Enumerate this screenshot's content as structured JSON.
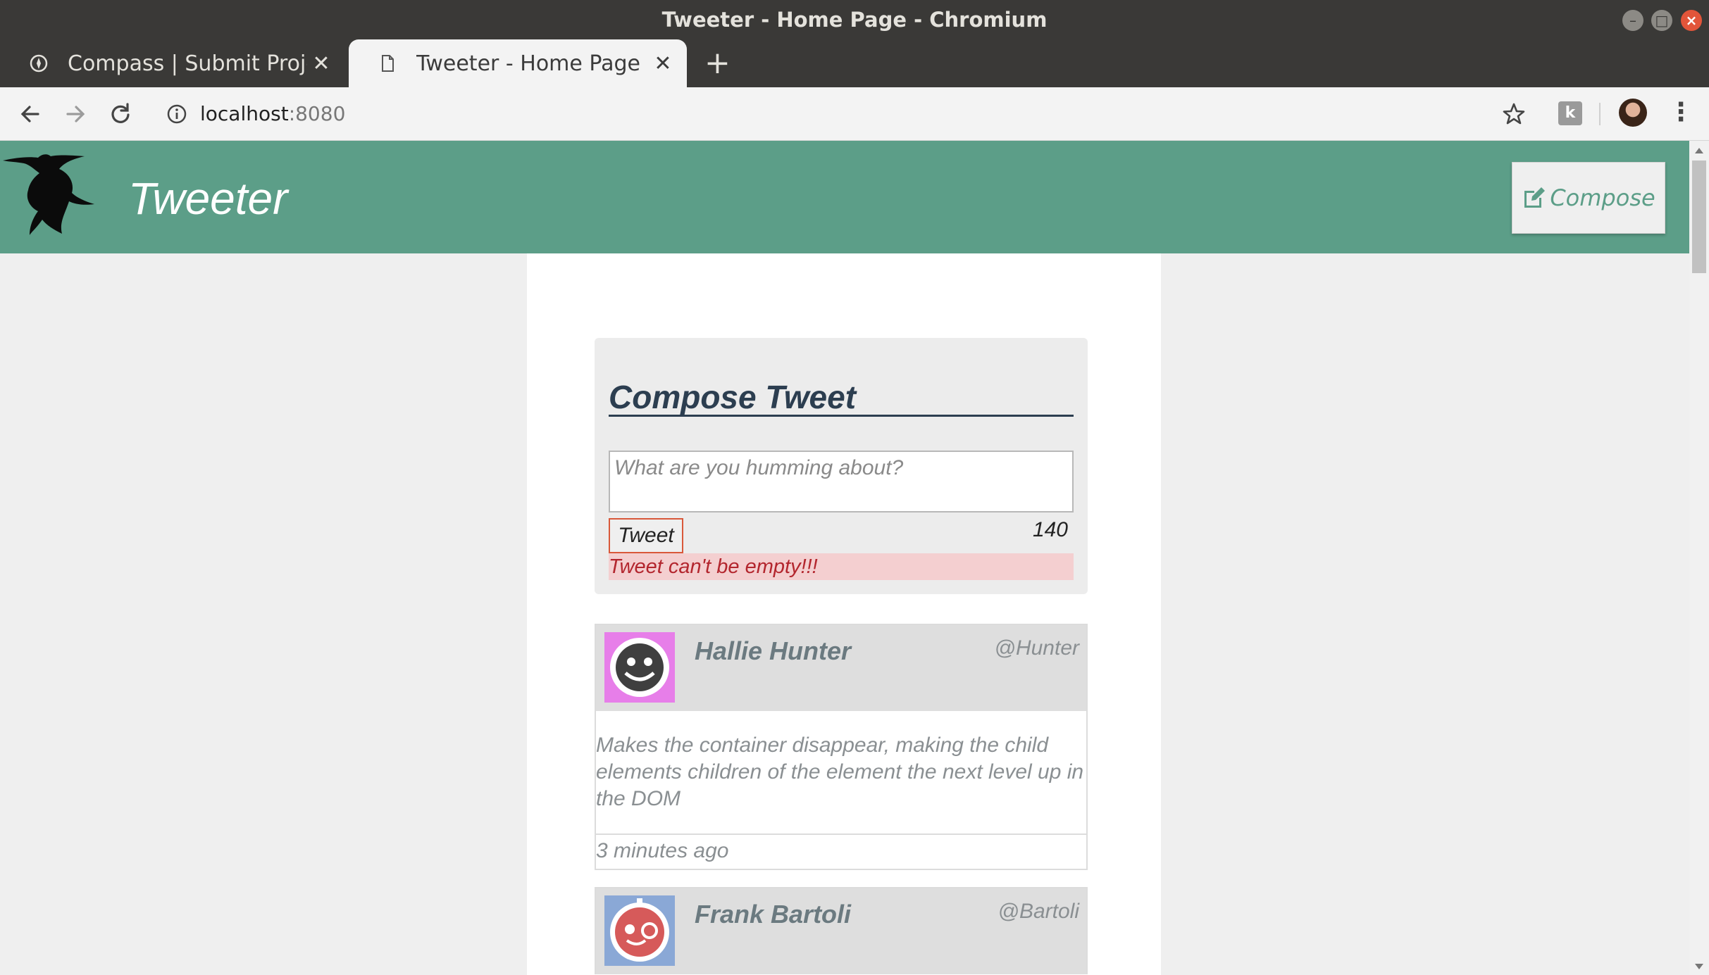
{
  "window": {
    "title": "Tweeter - Home Page - Chromium"
  },
  "tabs": [
    {
      "label": "Compass | Submit Project",
      "icon": "compass-icon",
      "active": false
    },
    {
      "label": "Tweeter - Home Page",
      "icon": "page-icon",
      "active": true
    }
  ],
  "toolbar": {
    "url_host": "localhost",
    "url_port": ":8080",
    "extension_label": "k"
  },
  "header": {
    "brand": "Tweeter",
    "compose_label": "Compose",
    "color": "#5c9e88"
  },
  "compose": {
    "title": "Compose Tweet",
    "placeholder": "What are you humming about?",
    "button_label": "Tweet",
    "counter": "140",
    "error": "Tweet can't be empty!!!"
  },
  "tweets": [
    {
      "name": "Hallie Hunter",
      "handle": "@Hunter",
      "text": "Makes the container disappear, making the child elements children of the element the next level up in the DOM",
      "time": "3 minutes ago",
      "avatar_color": "#e77ee9"
    },
    {
      "name": "Frank Bartoli",
      "handle": "@Bartoli",
      "text": "",
      "time": "",
      "avatar_color": "#8aa8d6"
    }
  ]
}
